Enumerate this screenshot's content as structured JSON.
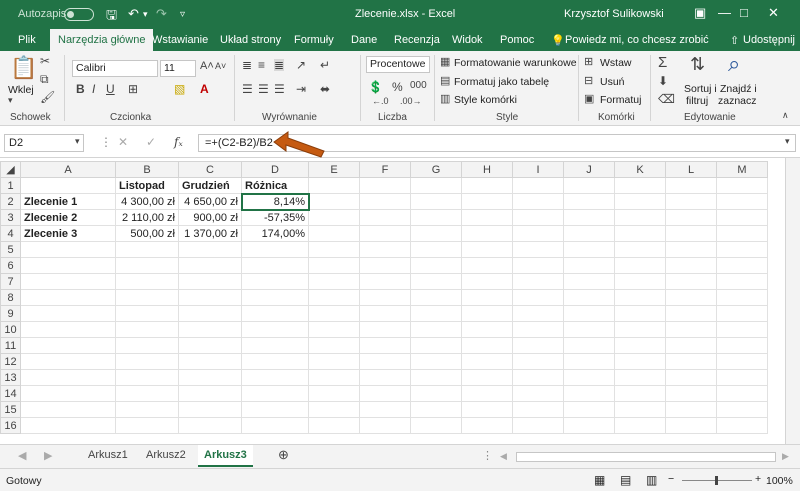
{
  "title": {
    "autosave": "Autozapis",
    "filename": "Zlecenie.xlsx - Excel",
    "user": "Krzysztof Sulikowski"
  },
  "tabs": [
    "Plik",
    "Narzędzia główne",
    "Wstawianie",
    "Układ strony",
    "Formuły",
    "Dane",
    "Recenzja",
    "Widok",
    "Pomoc"
  ],
  "tell_me": "Powiedz mi, co chcesz zrobić",
  "share": "Udostępnij",
  "ribbon": {
    "paste": "Wklej",
    "font": "Calibri",
    "font_size": "11",
    "number_format": "Procentowe",
    "cond_format": "Formatowanie warunkowe",
    "format_table": "Formatuj jako tabelę",
    "cell_styles": "Style komórki",
    "insert": "Wstaw",
    "delete": "Usuń",
    "format": "Formatuj",
    "sort1": "Sortuj i",
    "sort2": "filtruj",
    "find1": "Znajdź i",
    "find2": "zaznacz",
    "groups": [
      "Schowek",
      "Czcionka",
      "Wyrównanie",
      "Liczba",
      "Style",
      "Komórki",
      "Edytowanie"
    ]
  },
  "formula_bar": {
    "cell": "D2",
    "formula": "=+(C2-B2)/B2"
  },
  "columns": [
    "A",
    "B",
    "C",
    "D",
    "E",
    "F",
    "G",
    "H",
    "I",
    "J",
    "K",
    "L",
    "M"
  ],
  "rows": [
    [
      "",
      "Listopad",
      "Grudzień",
      "Różnica"
    ],
    [
      "Zlecenie 1",
      "4 300,00 zł",
      "4 650,00 zł",
      "8,14%"
    ],
    [
      "Zlecenie 2",
      "2 110,00 zł",
      "900,00 zł",
      "-57,35%"
    ],
    [
      "Zlecenie 3",
      "500,00 zł",
      "1 370,00 zł",
      "174,00%"
    ]
  ],
  "row_count": 16,
  "sheets": [
    "Arkusz1",
    "Arkusz2",
    "Arkusz3"
  ],
  "active_sheet": "Arkusz3",
  "status": {
    "ready": "Gotowy",
    "zoom": "100%"
  },
  "colors": {
    "accent": "#217346",
    "arrow": "#c55a11"
  },
  "icons": [
    "save-icon",
    "undo-icon",
    "redo-icon",
    "lightbulb-icon",
    "share-icon",
    "sum-icon",
    "sort-icon",
    "search-icon",
    "function-icon",
    "plus-icon"
  ]
}
